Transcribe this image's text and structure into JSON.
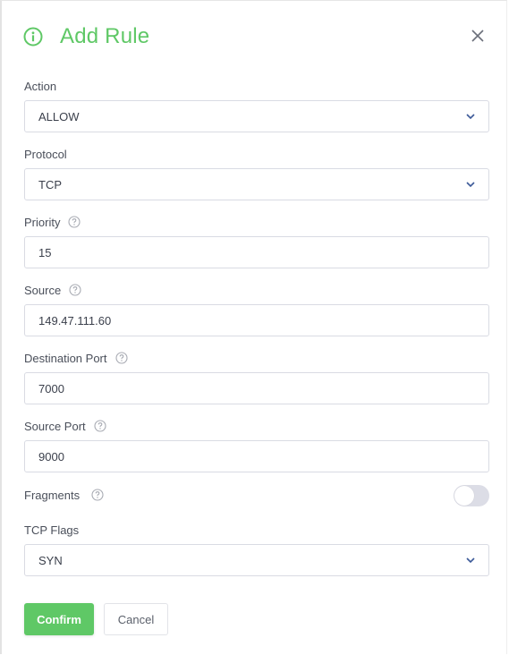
{
  "dialog": {
    "title": "Add Rule",
    "accent_color": "#5fc866"
  },
  "fields": {
    "action": {
      "label": "Action",
      "value": "ALLOW"
    },
    "protocol": {
      "label": "Protocol",
      "value": "TCP"
    },
    "priority": {
      "label": "Priority",
      "value": "15"
    },
    "source": {
      "label": "Source",
      "value": "149.47.111.60"
    },
    "destination_port": {
      "label": "Destination Port",
      "value": "7000"
    },
    "source_port": {
      "label": "Source Port",
      "value": "9000"
    },
    "fragments": {
      "label": "Fragments",
      "enabled": false
    },
    "tcp_flags": {
      "label": "TCP Flags",
      "value": "SYN"
    }
  },
  "buttons": {
    "confirm": "Confirm",
    "cancel": "Cancel"
  }
}
